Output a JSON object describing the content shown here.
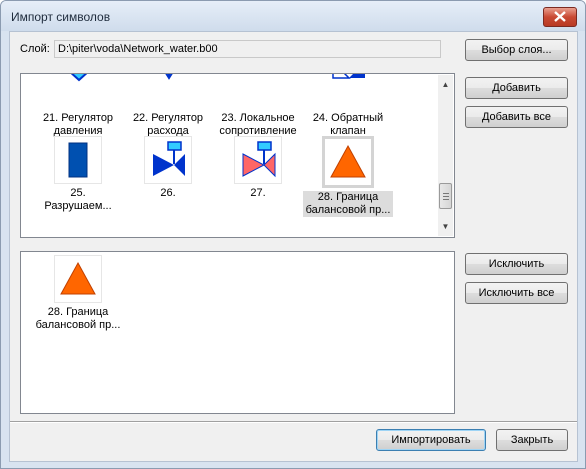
{
  "window": {
    "title": "Импорт символов"
  },
  "layer": {
    "label": "Слой:",
    "path": "D:\\piter\\voda\\Network_water.b00",
    "choose_button": "Выбор слоя..."
  },
  "buttons": {
    "add": "Добавить",
    "add_all": "Добавить все",
    "exclude": "Исключить",
    "exclude_all": "Исключить все",
    "import": "Импортировать",
    "close": "Закрыть"
  },
  "available_symbols": [
    {
      "caption": "21. Регулятор\nдавления",
      "icon": "pressure-regulator-icon"
    },
    {
      "caption": "22. Регулятор\nрасхода",
      "icon": "flow-regulator-icon"
    },
    {
      "caption": "23. Локальное\nсопротивление",
      "icon": "local-resistance-icon"
    },
    {
      "caption": "24. Обратный\nклапан",
      "icon": "check-valve-icon"
    },
    {
      "caption": "25.\nРазрушаем...",
      "icon": "destructible-block-icon"
    },
    {
      "caption": "26.",
      "icon": "valve-blue-icon"
    },
    {
      "caption": "27.",
      "icon": "valve-red-icon"
    },
    {
      "caption": "28. Граница\nбалансовой пр...",
      "icon": "balance-boundary-triangle-icon",
      "selected": true
    }
  ],
  "selected_symbols": [
    {
      "caption": "28. Граница\nбалансовой пр...",
      "icon": "balance-boundary-triangle-icon"
    }
  ],
  "colors": {
    "blue": "#0033cc",
    "cyan": "#33ccff",
    "red_pink": "#ff6666",
    "orange": "#ff6600",
    "titlebar": "#cfdcec"
  }
}
